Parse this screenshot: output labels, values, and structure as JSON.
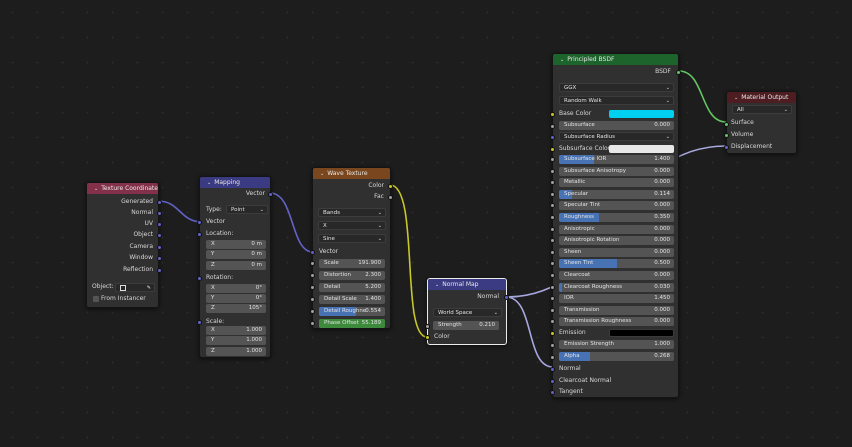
{
  "colors": {
    "header_input": "#83314a",
    "header_vector": "#3b3b83",
    "header_texture": "#79461d",
    "header_shader": "#1c632c",
    "header_output": "#4d1d22",
    "socket_vector": "#6363c7",
    "socket_color": "#c7c729",
    "socket_value": "#a1a1a1",
    "socket_shader": "#63c763",
    "base_color_swatch": "#00d0f0",
    "subsurface_color_swatch": "#e8e8e8",
    "emission_swatch": "#000000",
    "slider_fill": "#4772b3",
    "phase_fill": "#3d8a3d"
  },
  "texcoord": {
    "title": "Texture Coordinate",
    "outputs": [
      "Generated",
      "Normal",
      "UV",
      "Object",
      "Camera",
      "Window",
      "Reflection"
    ],
    "object_label": "Object:",
    "from_instancer": "From Instancer",
    "eyedropper_icon": "eyedropper-icon"
  },
  "mapping": {
    "title": "Mapping",
    "output": "Vector",
    "type_label": "Type:",
    "type_value": "Point",
    "input_vector": "Vector",
    "location_label": "Location:",
    "location": [
      {
        "axis": "X",
        "value": "0 m"
      },
      {
        "axis": "Y",
        "value": "0 m"
      },
      {
        "axis": "Z",
        "value": "0 m"
      }
    ],
    "rotation_label": "Rotation:",
    "rotation": [
      {
        "axis": "X",
        "value": "0°"
      },
      {
        "axis": "Y",
        "value": "0°"
      },
      {
        "axis": "Z",
        "value": "105°"
      }
    ],
    "scale_label": "Scale:",
    "scale": [
      {
        "axis": "X",
        "value": "1.000"
      },
      {
        "axis": "Y",
        "value": "1.000"
      },
      {
        "axis": "Z",
        "value": "1.000"
      }
    ]
  },
  "wave": {
    "title": "Wave Texture",
    "outputs": [
      "Color",
      "Fac"
    ],
    "wave_type": "Bands",
    "direction": "X",
    "profile": "Sine",
    "input_vector": "Vector",
    "fields": [
      {
        "label": "Scale",
        "value": "191.900",
        "fill": 0
      },
      {
        "label": "Distortion",
        "value": "2.300",
        "fill": 0
      },
      {
        "label": "Detail",
        "value": "5.200",
        "fill": 0
      },
      {
        "label": "Detail Scale",
        "value": "1.400",
        "fill": 0
      },
      {
        "label": "Detail Roughne",
        "value": "0.554",
        "fill": 0.554
      },
      {
        "label": "Phase Offset",
        "value": "55.189",
        "fill": 1
      }
    ]
  },
  "normalmap": {
    "title": "Normal Map",
    "output": "Normal",
    "space": "World Space",
    "strength_label": "Strength",
    "strength_value": "0.210",
    "input_color": "Color"
  },
  "bsdf": {
    "title": "Principled BSDF",
    "output": "BSDF",
    "distribution": "GGX",
    "subsurface_method": "Random Walk",
    "base_color_label": "Base Color",
    "subsurface_label": "Subsurface",
    "subsurface_value": "0.000",
    "subsurface_radius": "Subsurface Radius",
    "subsurface_color_label": "Subsurface Color",
    "fields": [
      {
        "label": "Subsurface IOR",
        "value": "1.400",
        "fill": 0.3
      },
      {
        "label": "Subsurface Anisotropy",
        "value": "0.000",
        "fill": 0
      },
      {
        "label": "Metallic",
        "value": "0.000",
        "fill": 0
      },
      {
        "label": "Specular",
        "value": "0.114",
        "fill": 0.114
      },
      {
        "label": "Specular Tint",
        "value": "0.000",
        "fill": 0
      },
      {
        "label": "Roughness",
        "value": "0.350",
        "fill": 0.35
      },
      {
        "label": "Anisotropic",
        "value": "0.000",
        "fill": 0
      },
      {
        "label": "Anisotropic Rotation",
        "value": "0.000",
        "fill": 0
      },
      {
        "label": "Sheen",
        "value": "0.000",
        "fill": 0
      },
      {
        "label": "Sheen Tint",
        "value": "0.500",
        "fill": 0.5
      },
      {
        "label": "Clearcoat",
        "value": "0.000",
        "fill": 0
      },
      {
        "label": "Clearcoat Roughness",
        "value": "0.030",
        "fill": 0.03
      },
      {
        "label": "IOR",
        "value": "1.450",
        "fill": 0
      },
      {
        "label": "Transmission",
        "value": "0.000",
        "fill": 0
      },
      {
        "label": "Transmission Roughness",
        "value": "0.000",
        "fill": 0
      }
    ],
    "emission_label": "Emission",
    "emission_strength_label": "Emission Strength",
    "emission_strength_value": "1.000",
    "alpha_label": "Alpha",
    "alpha_value": "0.268",
    "alpha_fill": 0.268,
    "normal_label": "Normal",
    "clearcoat_normal_label": "Clearcoat Normal",
    "tangent_label": "Tangent"
  },
  "output": {
    "title": "Material Output",
    "target": "All",
    "inputs": [
      "Surface",
      "Volume",
      "Displacement"
    ]
  }
}
